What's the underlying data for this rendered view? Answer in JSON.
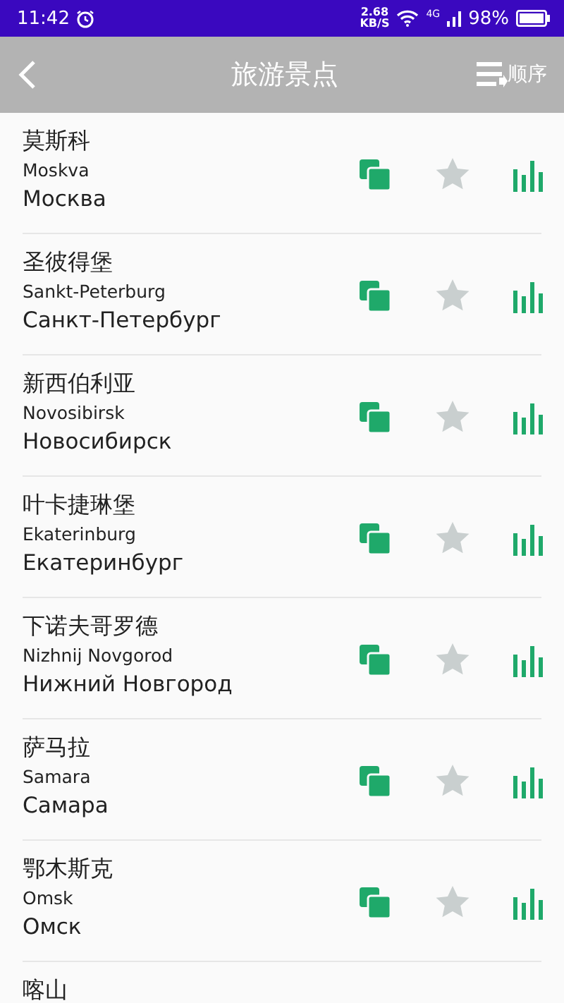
{
  "status_bar": {
    "time": "11:42",
    "speed": "2.68",
    "speed_unit": "KB/S",
    "network": "4G",
    "battery": "98%"
  },
  "header": {
    "title": "旅游景点",
    "sort_label": "顺序"
  },
  "cities": [
    {
      "name_zh": "莫斯科",
      "name_latin": "Moskva",
      "name_ru": "Москва",
      "favorite": false
    },
    {
      "name_zh": "圣彼得堡",
      "name_latin": "Sankt-Peterburg",
      "name_ru": "Санкт-Петербург",
      "favorite": false
    },
    {
      "name_zh": "新西伯利亚",
      "name_latin": "Novosibirsk",
      "name_ru": "Новосибирск",
      "favorite": false
    },
    {
      "name_zh": "叶卡捷琳堡",
      "name_latin": "Ekaterinburg",
      "name_ru": "Екатеринбург",
      "favorite": false
    },
    {
      "name_zh": "下诺夫哥罗德",
      "name_latin": "Nizhnij Novgorod",
      "name_ru": "Нижний Новгород",
      "favorite": false
    },
    {
      "name_zh": "萨马拉",
      "name_latin": "Samara",
      "name_ru": "Самара",
      "favorite": false
    },
    {
      "name_zh": "鄂木斯克",
      "name_latin": "Omsk",
      "name_ru": "Омск",
      "favorite": false
    },
    {
      "name_zh": "喀山"
    }
  ]
}
